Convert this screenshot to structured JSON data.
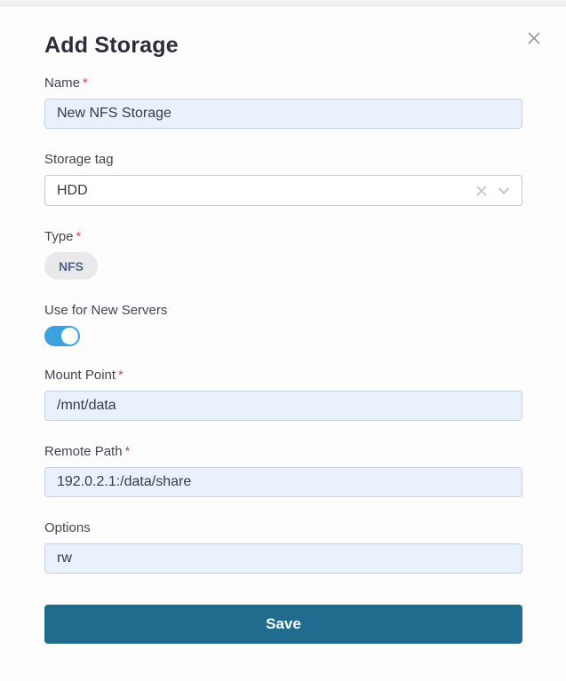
{
  "modal": {
    "title": "Add Storage"
  },
  "misc": {
    "required_mark": "*"
  },
  "fields": {
    "name": {
      "label": "Name",
      "required": true,
      "value": "New NFS Storage"
    },
    "storage_tag": {
      "label": "Storage tag",
      "required": false,
      "value": "HDD"
    },
    "type": {
      "label": "Type",
      "required": true,
      "value": "NFS"
    },
    "use_for_new_servers": {
      "label": "Use for New Servers",
      "enabled": true
    },
    "mount_point": {
      "label": "Mount Point",
      "required": true,
      "value": "/mnt/data"
    },
    "remote_path": {
      "label": "Remote Path",
      "required": true,
      "value": "192.0.2.1:/data/share"
    },
    "options": {
      "label": "Options",
      "required": false,
      "value": "rw"
    }
  },
  "icons": {
    "close": "close-icon",
    "clear": "clear-icon",
    "chevron_down": "chevron-down-icon"
  },
  "actions": {
    "save_label": "Save"
  },
  "colors": {
    "accent_toggle": "#3ba2de",
    "save_button": "#206c8e",
    "input_background": "#e9f2fc",
    "input_border": "#c5d2e0",
    "required_asterisk": "#dc4558",
    "pill_text": "#4e6286"
  }
}
